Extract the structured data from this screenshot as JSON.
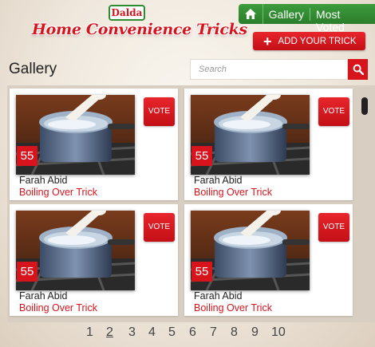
{
  "header": {
    "brand_badge": "Dalda",
    "title": "Home Convenience Tricks",
    "nav": {
      "home_icon": "home-icon",
      "gallery": "Gallery",
      "most_voted": "Most Voted"
    },
    "add_button": "ADD YOUR TRICK"
  },
  "page_title": "Gallery",
  "search": {
    "placeholder": "Search",
    "icon": "search-icon"
  },
  "cards": [
    {
      "votes": "55",
      "vote_label": "VOTE",
      "author": "Farah Abid",
      "title": "Boiling Over Trick"
    },
    {
      "votes": "55",
      "vote_label": "VOTE",
      "author": "Farah Abid",
      "title": "Boiling Over Trick"
    },
    {
      "votes": "55",
      "vote_label": "VOTE",
      "author": "Farah Abid",
      "title": "Boiling Over Trick"
    },
    {
      "votes": "55",
      "vote_label": "VOTE",
      "author": "Farah Abid",
      "title": "Boiling Over Trick"
    }
  ],
  "pagination": {
    "pages": [
      "1",
      "2",
      "3",
      "4",
      "5",
      "6",
      "7",
      "8",
      "9",
      "10"
    ],
    "current": "2"
  },
  "colors": {
    "accent_red": "#d7141c",
    "nav_green": "#2b7e2b",
    "background": "#efe7dc"
  }
}
